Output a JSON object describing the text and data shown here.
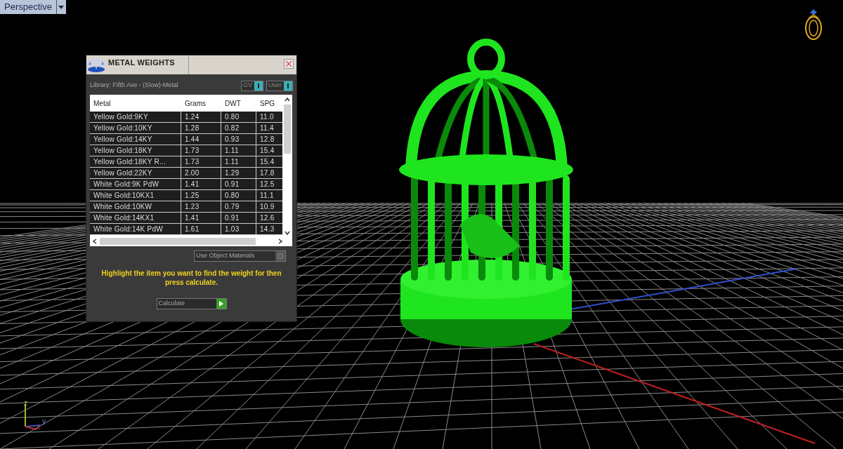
{
  "viewport": {
    "label": "Perspective",
    "axes": [
      "z",
      "y",
      "x"
    ]
  },
  "dialog": {
    "title": "METAL WEIGHTS",
    "library": "Library: Fifth Ave - (Slow)-Metal",
    "toggles": [
      {
        "label": "GV",
        "on": true
      },
      {
        "label": "User",
        "on": true
      }
    ],
    "table": {
      "columns": [
        "Metal",
        "Grams",
        "DWT",
        "SPG"
      ],
      "rows": [
        [
          "Yellow Gold:9KY",
          "1.24",
          "0.80",
          "11.0"
        ],
        [
          "Yellow Gold:10KY",
          "1.28",
          "0.82",
          "11.4"
        ],
        [
          "Yellow Gold:14KY",
          "1.44",
          "0.93",
          "12.8"
        ],
        [
          "Yellow Gold:18KY",
          "1.73",
          "1.11",
          "15.4"
        ],
        [
          "Yellow Gold:18KY R...",
          "1.73",
          "1.11",
          "15.4"
        ],
        [
          "Yellow Gold:22KY",
          "2.00",
          "1.29",
          "17.8"
        ],
        [
          "White Gold:9K PdW",
          "1.41",
          "0.91",
          "12.5"
        ],
        [
          "White Gold:10KX1",
          "1.25",
          "0.80",
          "11.1"
        ],
        [
          "White Gold:10KW",
          "1.23",
          "0.79",
          "10.9"
        ],
        [
          "White Gold:14KX1",
          "1.41",
          "0.91",
          "12.6"
        ],
        [
          "White Gold:14K PdW",
          "1.61",
          "1.03",
          "14.3"
        ]
      ]
    },
    "use_object_materials": {
      "label": "Use Object Materials",
      "checked": false
    },
    "hint": "Highlight the item you want to find the weight for then press calculate.",
    "button": "Calculate"
  }
}
